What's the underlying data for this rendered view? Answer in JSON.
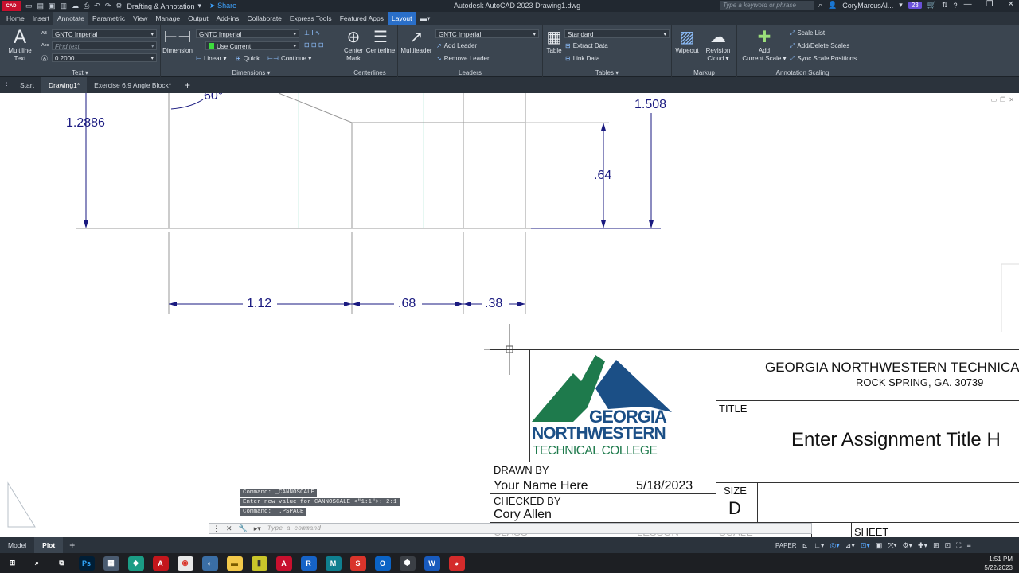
{
  "titlebar": {
    "app_logo": "CAD",
    "workspace": "Drafting & Annotation",
    "share": "Share",
    "window_title": "Autodesk AutoCAD 2023    Drawing1.dwg",
    "search_placeholder": "Type a keyword or phrase",
    "user": "CoryMarcusAl...",
    "badge": "23"
  },
  "menu_tabs": [
    "Home",
    "Insert",
    "Annotate",
    "Parametric",
    "View",
    "Manage",
    "Output",
    "Add-ins",
    "Collaborate",
    "Express Tools",
    "Featured Apps",
    "Layout"
  ],
  "ribbon": {
    "text": {
      "title": "Text",
      "multiline": "Multiline",
      "multiline2": "Text",
      "style": "GNTC Imperial",
      "find_placeholder": "Find text",
      "height": "0.2000"
    },
    "dimensions": {
      "title": "Dimensions",
      "dimension": "Dimension",
      "style": "GNTC Imperial",
      "layer": "Use Current",
      "linear": "Linear",
      "quick": "Quick",
      "continue": "Continue"
    },
    "centerlines": {
      "title": "Centerlines",
      "center_mark": "Center",
      "center_mark2": "Mark",
      "centerline": "Centerline"
    },
    "leaders": {
      "title": "Leaders",
      "multileader": "Multileader",
      "style": "GNTC Imperial",
      "add_leader": "Add Leader",
      "remove_leader": "Remove Leader"
    },
    "tables": {
      "title": "Tables",
      "table": "Table",
      "style": "Standard",
      "extract": "Extract Data",
      "link": "Link Data"
    },
    "markup": {
      "title": "Markup",
      "wipeout": "Wipeout",
      "revision": "Revision",
      "revision2": "Cloud"
    },
    "scaling": {
      "title": "Annotation Scaling",
      "add_scale": "Add",
      "add_scale2": "Current Scale",
      "scale_list": "Scale List",
      "add_delete": "Add/Delete Scales",
      "sync": "Sync Scale Positions"
    }
  },
  "doc_tabs": [
    "Start",
    "Drawing1*",
    "Exercise 6.9 Angle Block*"
  ],
  "drawing": {
    "dims": {
      "angle": "60°",
      "d1": "1.2886",
      "d2": "1.508",
      "d3": ".64",
      "d4": "1.12",
      "d5": ".68",
      "d6": ".38"
    }
  },
  "titleblock": {
    "school": "GEORGIA NORTHWESTERN TECHNICAL",
    "address": "ROCK SPRING, GA. 30739",
    "logo_line1": "GEORGIA",
    "logo_line2": "NORTHWESTERN",
    "logo_line3": "TECHNICAL COLLEGE",
    "title_label": "TITLE",
    "title_value": "Enter Assignment Title H",
    "drawn_by_label": "DRAWN BY",
    "drawn_by_value": "Your Name Here",
    "date": "5/18/2023",
    "checked_by_label": "CHECKED BY",
    "checked_by_value": "Cory Allen",
    "size_label": "SIZE",
    "size_value": "D",
    "class_label": "CLASS",
    "lesson_label": "LESSON",
    "scale_label": "SCALE",
    "sheet_label": "SHEET"
  },
  "command": {
    "history": [
      "Command:  _CANNOSCALE",
      "Enter new value for CANNOSCALE <\"1:1\">: 2:1",
      "Command:  _.PSPACE"
    ],
    "placeholder": "Type a command"
  },
  "status": {
    "tabs": [
      "Model",
      "Plot"
    ],
    "paper": "PAPER"
  },
  "taskbar": {
    "time": "1:51 PM",
    "date": "5/22/2023"
  },
  "colors": {
    "dim": "#1a1a80",
    "gntc_green": "#1e7a4c",
    "gntc_blue": "#1b4f86",
    "accent": "#2a6fc9"
  }
}
